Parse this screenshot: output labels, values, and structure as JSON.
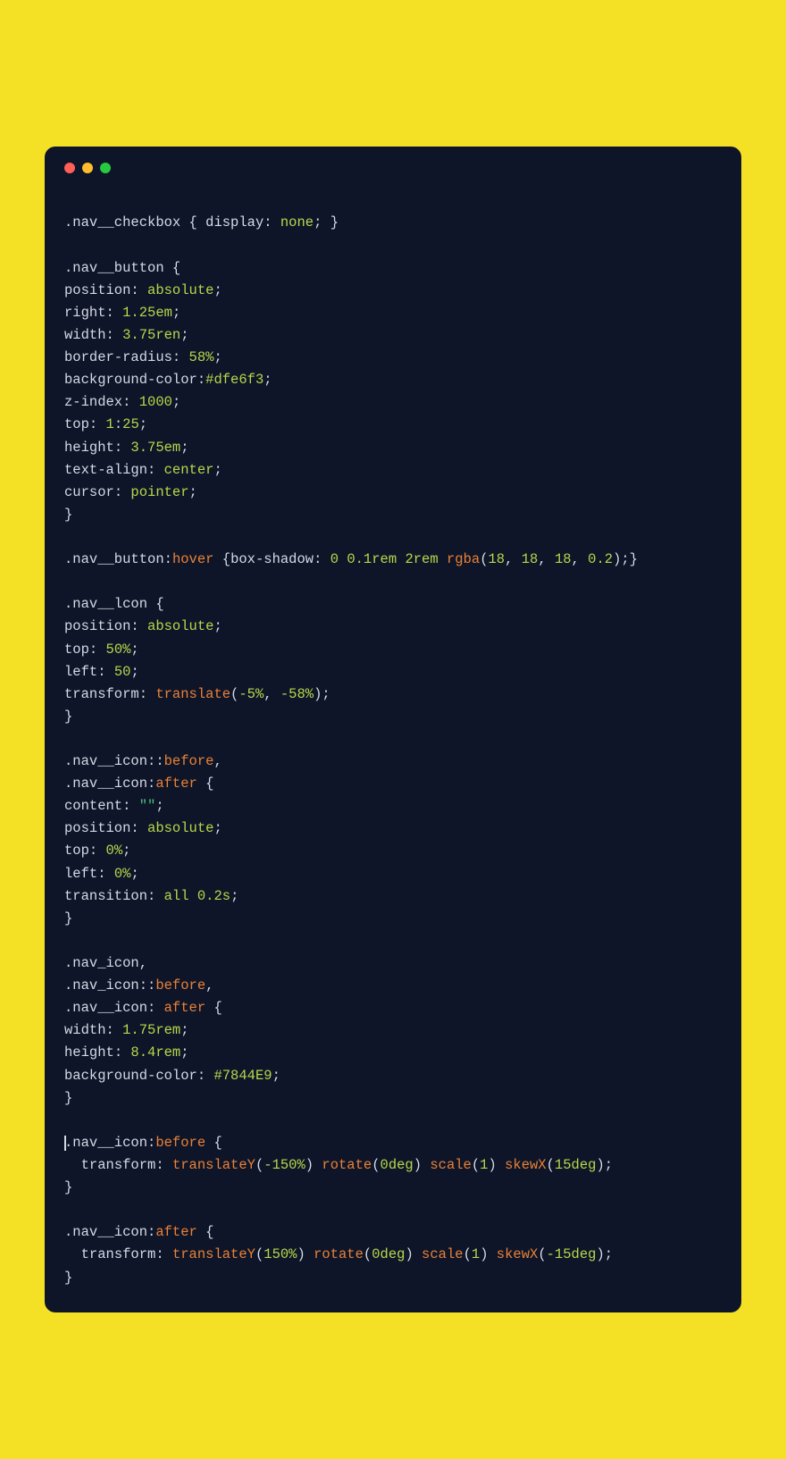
{
  "colors": {
    "page_bg": "#f4e125",
    "window_bg": "#0e1529",
    "text": "#d4d9e4",
    "value": "#b5d84a",
    "func": "#e98135",
    "string": "#4fbf7c"
  },
  "traffic_lights": {
    "red": "close-icon",
    "yellow": "minimize-icon",
    "green": "maximize-icon"
  },
  "code_lines": [
    [
      {
        "t": "",
        "c": "default"
      }
    ],
    [
      {
        "t": ".nav__checkbox",
        "c": "sel"
      },
      {
        "t": " { ",
        "c": "punc"
      },
      {
        "t": "display",
        "c": "prop"
      },
      {
        "t": ": ",
        "c": "punc"
      },
      {
        "t": "none",
        "c": "val"
      },
      {
        "t": "; }",
        "c": "punc"
      }
    ],
    [
      {
        "t": "",
        "c": "default"
      }
    ],
    [
      {
        "t": ".nav__button",
        "c": "sel"
      },
      {
        "t": " {",
        "c": "punc"
      }
    ],
    [
      {
        "t": "position",
        "c": "prop"
      },
      {
        "t": ": ",
        "c": "punc"
      },
      {
        "t": "absolute",
        "c": "val"
      },
      {
        "t": ";",
        "c": "punc"
      }
    ],
    [
      {
        "t": "right",
        "c": "prop"
      },
      {
        "t": ": ",
        "c": "punc"
      },
      {
        "t": "1.25em",
        "c": "num"
      },
      {
        "t": ";",
        "c": "punc"
      }
    ],
    [
      {
        "t": "width",
        "c": "prop"
      },
      {
        "t": ": ",
        "c": "punc"
      },
      {
        "t": "3.75ren",
        "c": "num"
      },
      {
        "t": ";",
        "c": "punc"
      }
    ],
    [
      {
        "t": "border-radius",
        "c": "prop"
      },
      {
        "t": ": ",
        "c": "punc"
      },
      {
        "t": "58%",
        "c": "num"
      },
      {
        "t": ";",
        "c": "punc"
      }
    ],
    [
      {
        "t": "background-color",
        "c": "prop"
      },
      {
        "t": ":",
        "c": "punc"
      },
      {
        "t": "#dfe6f3",
        "c": "hex"
      },
      {
        "t": ";",
        "c": "punc"
      }
    ],
    [
      {
        "t": "z-index",
        "c": "prop"
      },
      {
        "t": ": ",
        "c": "punc"
      },
      {
        "t": "1000",
        "c": "num"
      },
      {
        "t": ";",
        "c": "punc"
      }
    ],
    [
      {
        "t": "top",
        "c": "prop"
      },
      {
        "t": ": ",
        "c": "punc"
      },
      {
        "t": "1",
        "c": "num"
      },
      {
        "t": ":",
        "c": "punc"
      },
      {
        "t": "25",
        "c": "num"
      },
      {
        "t": ";",
        "c": "punc"
      }
    ],
    [
      {
        "t": "height",
        "c": "prop"
      },
      {
        "t": ": ",
        "c": "punc"
      },
      {
        "t": "3.75em",
        "c": "num"
      },
      {
        "t": ";",
        "c": "punc"
      }
    ],
    [
      {
        "t": "text-align",
        "c": "prop"
      },
      {
        "t": ": ",
        "c": "punc"
      },
      {
        "t": "center",
        "c": "val"
      },
      {
        "t": ";",
        "c": "punc"
      }
    ],
    [
      {
        "t": "cursor",
        "c": "prop"
      },
      {
        "t": ": ",
        "c": "punc"
      },
      {
        "t": "pointer",
        "c": "val"
      },
      {
        "t": ";",
        "c": "punc"
      }
    ],
    [
      {
        "t": "}",
        "c": "punc"
      }
    ],
    [
      {
        "t": "",
        "c": "default"
      }
    ],
    [
      {
        "t": ".nav__button",
        "c": "sel"
      },
      {
        "t": ":",
        "c": "punc"
      },
      {
        "t": "hover",
        "c": "pseudo"
      },
      {
        "t": " {",
        "c": "punc"
      },
      {
        "t": "box-shadow",
        "c": "prop"
      },
      {
        "t": ": ",
        "c": "punc"
      },
      {
        "t": "0",
        "c": "num"
      },
      {
        "t": " ",
        "c": "punc"
      },
      {
        "t": "0.1rem",
        "c": "num"
      },
      {
        "t": " ",
        "c": "punc"
      },
      {
        "t": "2rem",
        "c": "num"
      },
      {
        "t": " ",
        "c": "punc"
      },
      {
        "t": "rgba",
        "c": "fn"
      },
      {
        "t": "(",
        "c": "punc"
      },
      {
        "t": "18",
        "c": "num"
      },
      {
        "t": ", ",
        "c": "punc"
      },
      {
        "t": "18",
        "c": "num"
      },
      {
        "t": ", ",
        "c": "punc"
      },
      {
        "t": "18",
        "c": "num"
      },
      {
        "t": ", ",
        "c": "punc"
      },
      {
        "t": "0.2",
        "c": "num"
      },
      {
        "t": ");}",
        "c": "punc"
      }
    ],
    [
      {
        "t": "",
        "c": "default"
      }
    ],
    [
      {
        "t": ".nav__lcon",
        "c": "sel"
      },
      {
        "t": " {",
        "c": "punc"
      }
    ],
    [
      {
        "t": "position",
        "c": "prop"
      },
      {
        "t": ": ",
        "c": "punc"
      },
      {
        "t": "absolute",
        "c": "val"
      },
      {
        "t": ";",
        "c": "punc"
      }
    ],
    [
      {
        "t": "top",
        "c": "prop"
      },
      {
        "t": ": ",
        "c": "punc"
      },
      {
        "t": "50%",
        "c": "num"
      },
      {
        "t": ";",
        "c": "punc"
      }
    ],
    [
      {
        "t": "left",
        "c": "prop"
      },
      {
        "t": ": ",
        "c": "punc"
      },
      {
        "t": "50",
        "c": "num"
      },
      {
        "t": ";",
        "c": "punc"
      }
    ],
    [
      {
        "t": "transform",
        "c": "prop"
      },
      {
        "t": ": ",
        "c": "punc"
      },
      {
        "t": "translate",
        "c": "fn"
      },
      {
        "t": "(",
        "c": "punc"
      },
      {
        "t": "-5%",
        "c": "num"
      },
      {
        "t": ", ",
        "c": "punc"
      },
      {
        "t": "-58%",
        "c": "num"
      },
      {
        "t": ");",
        "c": "punc"
      }
    ],
    [
      {
        "t": "}",
        "c": "punc"
      }
    ],
    [
      {
        "t": "",
        "c": "default"
      }
    ],
    [
      {
        "t": ".nav__icon",
        "c": "sel"
      },
      {
        "t": "::",
        "c": "punc"
      },
      {
        "t": "before",
        "c": "pseudo"
      },
      {
        "t": ",",
        "c": "punc"
      }
    ],
    [
      {
        "t": ".nav__icon",
        "c": "sel"
      },
      {
        "t": ":",
        "c": "punc"
      },
      {
        "t": "after",
        "c": "pseudo"
      },
      {
        "t": " {",
        "c": "punc"
      }
    ],
    [
      {
        "t": "content",
        "c": "prop"
      },
      {
        "t": ": ",
        "c": "punc"
      },
      {
        "t": "\"\"",
        "c": "str"
      },
      {
        "t": ";",
        "c": "punc"
      }
    ],
    [
      {
        "t": "position",
        "c": "prop"
      },
      {
        "t": ": ",
        "c": "punc"
      },
      {
        "t": "absolute",
        "c": "val"
      },
      {
        "t": ";",
        "c": "punc"
      }
    ],
    [
      {
        "t": "top",
        "c": "prop"
      },
      {
        "t": ": ",
        "c": "punc"
      },
      {
        "t": "0%",
        "c": "num"
      },
      {
        "t": ";",
        "c": "punc"
      }
    ],
    [
      {
        "t": "left",
        "c": "prop"
      },
      {
        "t": ": ",
        "c": "punc"
      },
      {
        "t": "0%",
        "c": "num"
      },
      {
        "t": ";",
        "c": "punc"
      }
    ],
    [
      {
        "t": "transition",
        "c": "prop"
      },
      {
        "t": ": ",
        "c": "punc"
      },
      {
        "t": "all",
        "c": "val"
      },
      {
        "t": " ",
        "c": "punc"
      },
      {
        "t": "0.2s",
        "c": "num"
      },
      {
        "t": ";",
        "c": "punc"
      }
    ],
    [
      {
        "t": "}",
        "c": "punc"
      }
    ],
    [
      {
        "t": "",
        "c": "default"
      }
    ],
    [
      {
        "t": ".nav_icon",
        "c": "sel"
      },
      {
        "t": ",",
        "c": "punc"
      }
    ],
    [
      {
        "t": ".nav_icon",
        "c": "sel"
      },
      {
        "t": "::",
        "c": "punc"
      },
      {
        "t": "before",
        "c": "pseudo"
      },
      {
        "t": ",",
        "c": "punc"
      }
    ],
    [
      {
        "t": ".nav__icon",
        "c": "sel"
      },
      {
        "t": ": ",
        "c": "punc"
      },
      {
        "t": "after",
        "c": "pseudo"
      },
      {
        "t": " {",
        "c": "punc"
      }
    ],
    [
      {
        "t": "width",
        "c": "prop"
      },
      {
        "t": ": ",
        "c": "punc"
      },
      {
        "t": "1.75rem",
        "c": "num"
      },
      {
        "t": ";",
        "c": "punc"
      }
    ],
    [
      {
        "t": "height",
        "c": "prop"
      },
      {
        "t": ": ",
        "c": "punc"
      },
      {
        "t": "8.4rem",
        "c": "num"
      },
      {
        "t": ";",
        "c": "punc"
      }
    ],
    [
      {
        "t": "background-color",
        "c": "prop"
      },
      {
        "t": ": ",
        "c": "punc"
      },
      {
        "t": "#7844E9",
        "c": "hex"
      },
      {
        "t": ";",
        "c": "punc"
      }
    ],
    [
      {
        "t": "}",
        "c": "punc"
      }
    ],
    [
      {
        "t": "",
        "c": "default"
      }
    ],
    [
      {
        "cursor": true
      },
      {
        "t": ".nav__icon",
        "c": "sel"
      },
      {
        "t": ":",
        "c": "punc"
      },
      {
        "t": "before",
        "c": "pseudo"
      },
      {
        "t": " {",
        "c": "punc"
      }
    ],
    [
      {
        "t": "  transform",
        "c": "prop"
      },
      {
        "t": ": ",
        "c": "punc"
      },
      {
        "t": "translateY",
        "c": "fn"
      },
      {
        "t": "(",
        "c": "punc"
      },
      {
        "t": "-150%",
        "c": "num"
      },
      {
        "t": ") ",
        "c": "punc"
      },
      {
        "t": "rotate",
        "c": "fn"
      },
      {
        "t": "(",
        "c": "punc"
      },
      {
        "t": "0deg",
        "c": "num"
      },
      {
        "t": ") ",
        "c": "punc"
      },
      {
        "t": "scale",
        "c": "fn"
      },
      {
        "t": "(",
        "c": "punc"
      },
      {
        "t": "1",
        "c": "num"
      },
      {
        "t": ") ",
        "c": "punc"
      },
      {
        "t": "skewX",
        "c": "fn"
      },
      {
        "t": "(",
        "c": "punc"
      },
      {
        "t": "15deg",
        "c": "num"
      },
      {
        "t": ");",
        "c": "punc"
      }
    ],
    [
      {
        "t": "}",
        "c": "punc"
      }
    ],
    [
      {
        "t": "",
        "c": "default"
      }
    ],
    [
      {
        "t": ".nav__icon",
        "c": "sel"
      },
      {
        "t": ":",
        "c": "punc"
      },
      {
        "t": "after",
        "c": "pseudo"
      },
      {
        "t": " {",
        "c": "punc"
      }
    ],
    [
      {
        "t": "  transform",
        "c": "prop"
      },
      {
        "t": ": ",
        "c": "punc"
      },
      {
        "t": "translateY",
        "c": "fn"
      },
      {
        "t": "(",
        "c": "punc"
      },
      {
        "t": "150%",
        "c": "num"
      },
      {
        "t": ") ",
        "c": "punc"
      },
      {
        "t": "rotate",
        "c": "fn"
      },
      {
        "t": "(",
        "c": "punc"
      },
      {
        "t": "0deg",
        "c": "num"
      },
      {
        "t": ") ",
        "c": "punc"
      },
      {
        "t": "scale",
        "c": "fn"
      },
      {
        "t": "(",
        "c": "punc"
      },
      {
        "t": "1",
        "c": "num"
      },
      {
        "t": ") ",
        "c": "punc"
      },
      {
        "t": "skewX",
        "c": "fn"
      },
      {
        "t": "(",
        "c": "punc"
      },
      {
        "t": "-15deg",
        "c": "num"
      },
      {
        "t": ");",
        "c": "punc"
      }
    ],
    [
      {
        "t": "}",
        "c": "punc"
      }
    ]
  ]
}
